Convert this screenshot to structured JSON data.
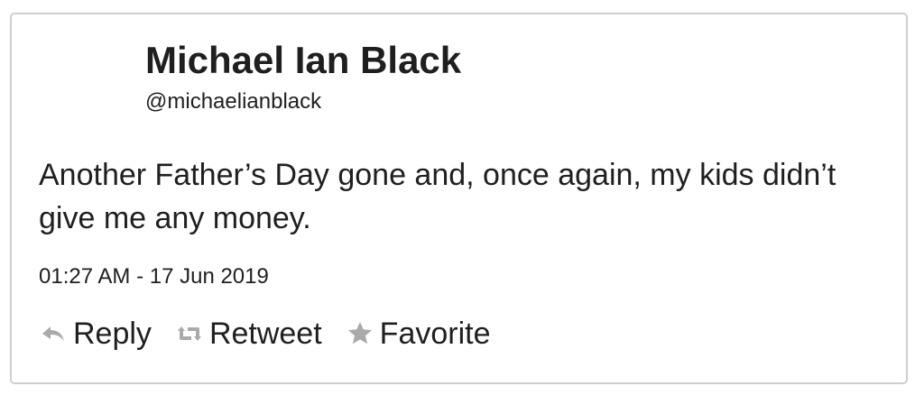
{
  "author": {
    "name": "Michael Ian Black",
    "handle": "@michaelianblack"
  },
  "tweet": {
    "text": "Another Father’s Day gone and, once again, my kids didn’t give me any money.",
    "timestamp": "01:27 AM - 17 Jun 2019"
  },
  "actions": {
    "reply": {
      "label": "Reply",
      "icon": "reply-icon"
    },
    "retweet": {
      "label": "Retweet",
      "icon": "retweet-icon"
    },
    "favorite": {
      "label": "Favorite",
      "icon": "star-icon"
    }
  },
  "colors": {
    "text": "#1f1f1f",
    "icon": "#aaaaaa",
    "border": "#cfcfcf",
    "background": "#ffffff"
  }
}
